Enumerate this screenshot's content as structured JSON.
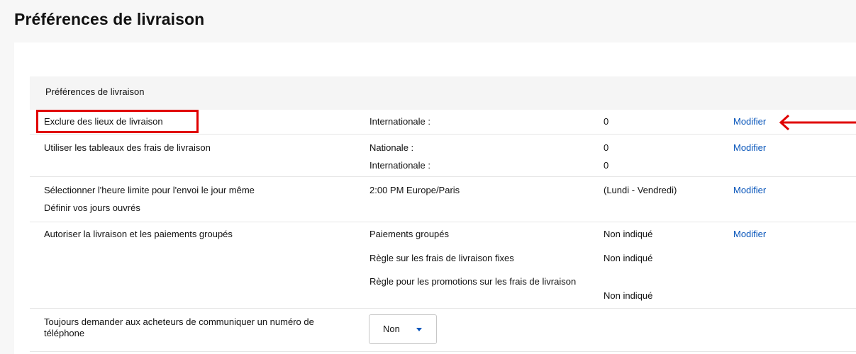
{
  "page": {
    "title": "Préférences de livraison"
  },
  "section": {
    "header": "Préférences de livraison"
  },
  "rows": [
    {
      "label": "Exclure des lieux de livraison",
      "details": [
        {
          "name": "Internationale :",
          "value": "0"
        }
      ],
      "action": "Modifier"
    },
    {
      "label": "Utiliser les tableaux des frais de livraison",
      "details": [
        {
          "name": "Nationale :",
          "value": "0"
        },
        {
          "name": "Internationale :",
          "value": "0"
        }
      ],
      "action": "Modifier"
    },
    {
      "label": "Sélectionner l'heure limite pour l'envoi le jour même",
      "sublabel": "Définir vos jours ouvrés",
      "details": [
        {
          "name": "2:00 PM Europe/Paris",
          "value": "(Lundi - Vendredi)"
        }
      ],
      "action": "Modifier"
    },
    {
      "label": "Autoriser la livraison et les paiements groupés",
      "details": [
        {
          "name": "Paiements groupés",
          "value": "Non indiqué"
        },
        {
          "name": "Règle sur les frais de livraison fixes",
          "value": "Non indiqué"
        },
        {
          "name": "Règle pour les promotions sur les frais de livraison",
          "value": "Non indiqué"
        }
      ],
      "action": "Modifier"
    },
    {
      "label": "Toujours demander aux acheteurs de communiquer un numéro de téléphone",
      "select": {
        "value": "Non"
      }
    }
  ],
  "annotation": {
    "highlight_color": "#e00000",
    "arrow_color": "#e00000"
  },
  "colors": {
    "link": "#0654ba",
    "section_header_bg": "#f5f5f5",
    "page_bg": "#f7f7f7"
  }
}
